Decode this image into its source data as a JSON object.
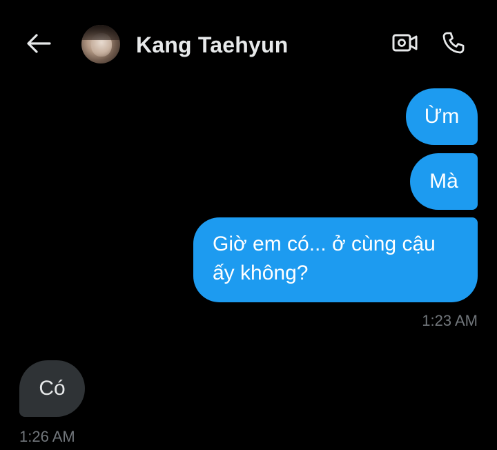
{
  "header": {
    "contact_name": "Kang Taehyun",
    "back_icon": "arrow-left-icon",
    "video_icon": "video-camera-icon",
    "call_icon": "phone-icon"
  },
  "messages": [
    {
      "direction": "sent",
      "text": "Ừm"
    },
    {
      "direction": "sent",
      "text": "Mà"
    },
    {
      "direction": "sent",
      "text": "Giờ em có... ở cùng cậu ấy không?",
      "time": "1:23 AM"
    },
    {
      "direction": "received",
      "text": "Có",
      "time": "1:26 AM"
    }
  ],
  "colors": {
    "background": "#000000",
    "sent_bubble": "#1d9bf0",
    "received_bubble": "#2f3336",
    "timestamp": "#71767b",
    "text_primary": "#e7e9ea"
  }
}
